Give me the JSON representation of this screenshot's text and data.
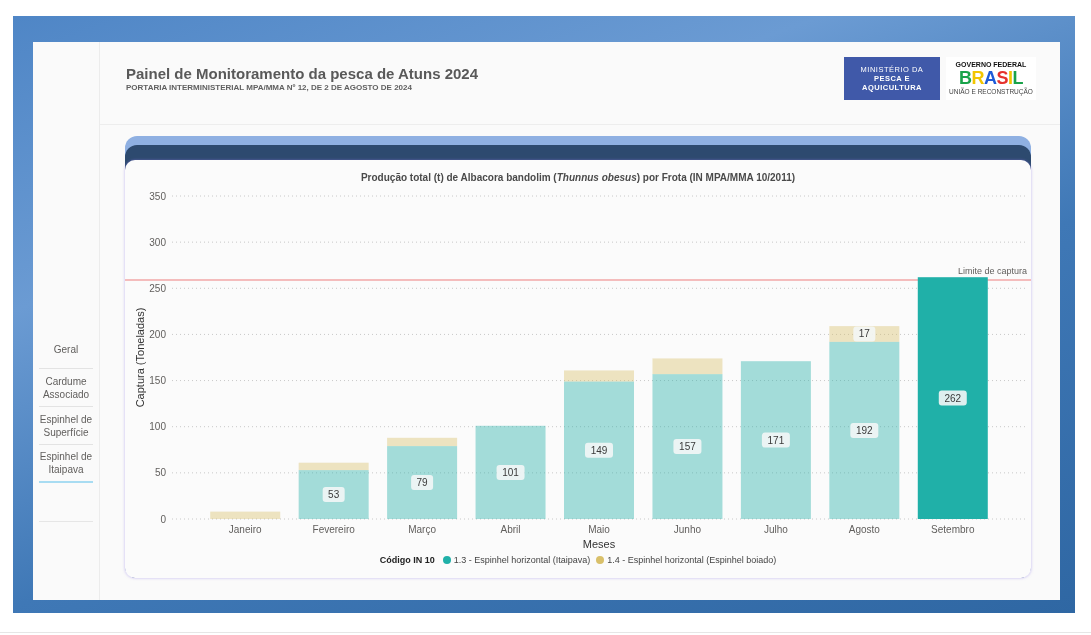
{
  "header": {
    "title": "Painel de Monitoramento da pesca de Atuns 2024",
    "subtitle": "PORTARIA INTERMINISTERIAL MPA/MMA Nº 12, DE 2 DE AGOSTO DE 2024",
    "logos": [
      {
        "kind": "ministry",
        "lines": [
          "MINISTÉRIO DA",
          "PESCA E",
          "AQUICULTURA"
        ]
      },
      {
        "kind": "government",
        "lines": [
          "GOVERNO FEDERAL",
          "BRASIL",
          "UNIÃO E RECONSTRUÇÃO"
        ]
      }
    ]
  },
  "sidebar": {
    "items": [
      {
        "label": "Geral",
        "selected": false
      },
      {
        "label": "Cardume Associado",
        "selected": false
      },
      {
        "label": "Espinhel de Superfície",
        "selected": false
      },
      {
        "label": "Espinhel de Itaipava",
        "selected": true
      }
    ]
  },
  "chart": {
    "legend_title": "Código IN 10",
    "month_states": [
      {
        "selected": false
      },
      {
        "selected": false
      },
      {
        "selected": false
      },
      {
        "selected": false
      },
      {
        "selected": false
      },
      {
        "selected": false
      },
      {
        "selected": false
      },
      {
        "selected": false
      },
      {
        "selected": true
      }
    ],
    "chart_data": {
      "type": "bar",
      "stacked": true,
      "orientation": "vertical",
      "grid": true,
      "title": "Produção total (t) de Albacora bandolim (*Thunnus obesus*) por Frota (IN MPA/MMA 10/2011)",
      "xlabel": "Meses",
      "ylabel": "Captura (Toneladas)",
      "categories": [
        "Janeiro",
        "Fevereiro",
        "Março",
        "Abril",
        "Maio",
        "Junho",
        "Julho",
        "Agosto",
        "Setembro"
      ],
      "series": [
        {
          "name": "1.3 - Espinhel horizontal (Itaipava)",
          "color": "#20b0a8",
          "values": [
            null,
            53,
            79,
            101,
            149,
            157,
            171,
            192,
            262
          ]
        },
        {
          "name": "1.4 - Espinhel horizontal (Espinhel boiado)",
          "color": "#d9c06a",
          "values": [
            8,
            8,
            9,
            null,
            12,
            17,
            null,
            17,
            null
          ]
        }
      ],
      "ylim": [
        0,
        350
      ],
      "yticks": [
        0,
        50,
        100,
        150,
        200,
        250,
        300,
        350
      ],
      "value_labels": [
        [
          null,
          "53",
          "79",
          "101",
          "149",
          "157",
          "171",
          "192",
          "262"
        ],
        [
          null,
          null,
          null,
          null,
          null,
          null,
          null,
          "17",
          null
        ]
      ],
      "ref_lines": [
        {
          "axis": "y",
          "value": 259,
          "label": "Limite de captura",
          "color": "#f2a7a7"
        }
      ]
    }
  }
}
